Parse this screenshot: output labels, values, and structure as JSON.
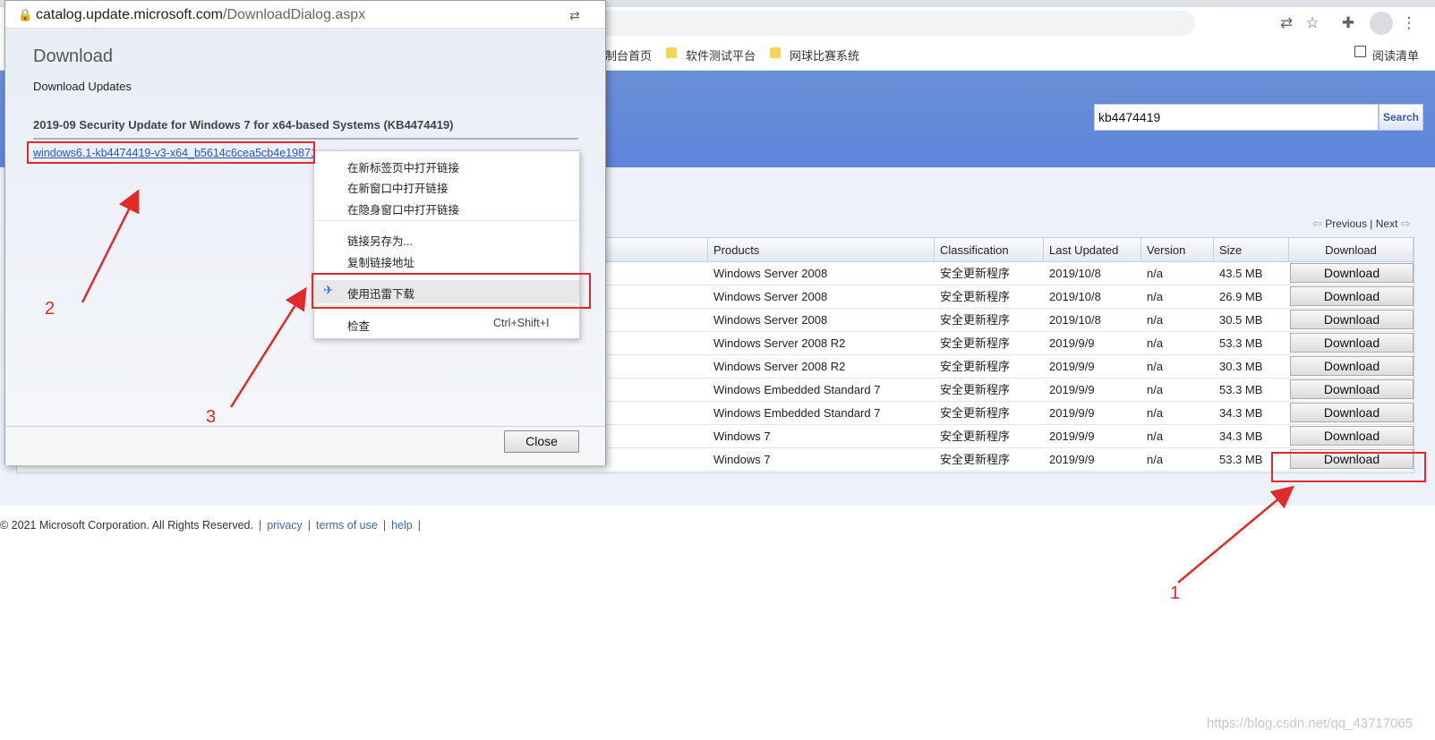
{
  "browser": {
    "bookmarks": [
      "制台首页",
      "软件测试平台",
      "网球比赛系统"
    ],
    "reading_list": "阅读清单"
  },
  "catalog": {
    "search_value": "kb4474419",
    "search_label": "Search",
    "pager_previous": "Previous",
    "pager_sep": "|",
    "pager_next": "Next",
    "columns": [
      "Products",
      "Classification",
      "Last Updated",
      "Version",
      "Size",
      "Download"
    ],
    "rows": [
      {
        "product": "Windows Server 2008",
        "classification": "安全更新程序",
        "updated": "2019/10/8",
        "version": "n/a",
        "size": "43.5 MB",
        "button": "Download"
      },
      {
        "product": "Windows Server 2008",
        "classification": "安全更新程序",
        "updated": "2019/10/8",
        "version": "n/a",
        "size": "26.9 MB",
        "button": "Download"
      },
      {
        "product": "Windows Server 2008",
        "classification": "安全更新程序",
        "updated": "2019/10/8",
        "version": "n/a",
        "size": "30.5 MB",
        "button": "Download"
      },
      {
        "product": "Windows Server 2008 R2",
        "classification": "安全更新程序",
        "updated": "2019/9/9",
        "version": "n/a",
        "size": "53.3 MB",
        "button": "Download"
      },
      {
        "product": "Windows Server 2008 R2",
        "classification": "安全更新程序",
        "updated": "2019/9/9",
        "version": "n/a",
        "size": "30.3 MB",
        "button": "Download"
      },
      {
        "product": "Windows Embedded Standard 7",
        "classification": "安全更新程序",
        "updated": "2019/9/9",
        "version": "n/a",
        "size": "53.3 MB",
        "button": "Download"
      },
      {
        "product": "Windows Embedded Standard 7",
        "classification": "安全更新程序",
        "updated": "2019/9/9",
        "version": "n/a",
        "size": "34.3 MB",
        "button": "Download"
      },
      {
        "product": "Windows 7",
        "classification": "安全更新程序",
        "updated": "2019/9/9",
        "version": "n/a",
        "size": "34.3 MB",
        "button": "Download"
      },
      {
        "product": "Windows 7",
        "classification": "安全更新程序",
        "updated": "2019/9/9",
        "version": "n/a",
        "size": "53.3 MB",
        "button": "Download"
      }
    ],
    "footer": {
      "copyright": "© 2021 Microsoft Corporation. All Rights Reserved.",
      "links": [
        "privacy",
        "terms of use",
        "help"
      ]
    }
  },
  "popup": {
    "url_host": "catalog.update.microsoft.com",
    "url_path": "/DownloadDialog.aspx",
    "title": "Download",
    "subtitle": "Download Updates",
    "update_title": "2019-09 Security Update for Windows 7 for x64-based Systems (KB4474419)",
    "file_link": "windows6.1-kb4474419-v3-x64_b5614c6cea5cb4e19871",
    "close_label": "Close"
  },
  "context_menu": {
    "items": [
      "在新标签页中打开链接",
      "在新窗口中打开链接",
      "在隐身窗口中打开链接",
      "链接另存为...",
      "复制链接地址",
      "使用迅雷下载",
      "检查"
    ],
    "inspect_shortcut": "Ctrl+Shift+I"
  },
  "annotations": [
    "1",
    "2",
    "3"
  ],
  "watermark": "https://blog.csdn.net/qq_43717065",
  "colors": {
    "accent_red": "#e32a2a",
    "banner_blue": "#5d85db",
    "link_blue": "#2a56c6"
  }
}
